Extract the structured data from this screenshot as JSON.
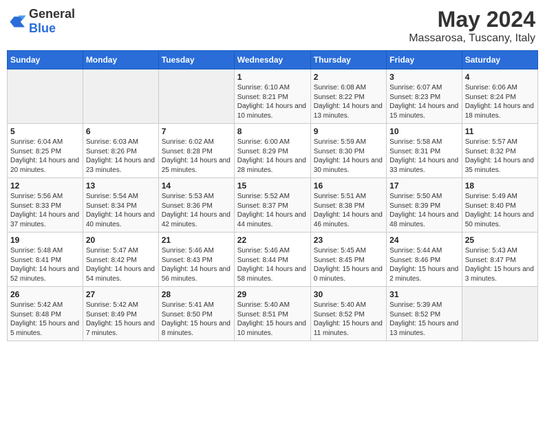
{
  "logo": {
    "general": "General",
    "blue": "Blue"
  },
  "header": {
    "month": "May 2024",
    "location": "Massarosa, Tuscany, Italy"
  },
  "weekdays": [
    "Sunday",
    "Monday",
    "Tuesday",
    "Wednesday",
    "Thursday",
    "Friday",
    "Saturday"
  ],
  "weeks": [
    [
      {
        "day": "",
        "sunrise": "",
        "sunset": "",
        "daylight": ""
      },
      {
        "day": "",
        "sunrise": "",
        "sunset": "",
        "daylight": ""
      },
      {
        "day": "",
        "sunrise": "",
        "sunset": "",
        "daylight": ""
      },
      {
        "day": "1",
        "sunrise": "Sunrise: 6:10 AM",
        "sunset": "Sunset: 8:21 PM",
        "daylight": "Daylight: 14 hours and 10 minutes."
      },
      {
        "day": "2",
        "sunrise": "Sunrise: 6:08 AM",
        "sunset": "Sunset: 8:22 PM",
        "daylight": "Daylight: 14 hours and 13 minutes."
      },
      {
        "day": "3",
        "sunrise": "Sunrise: 6:07 AM",
        "sunset": "Sunset: 8:23 PM",
        "daylight": "Daylight: 14 hours and 15 minutes."
      },
      {
        "day": "4",
        "sunrise": "Sunrise: 6:06 AM",
        "sunset": "Sunset: 8:24 PM",
        "daylight": "Daylight: 14 hours and 18 minutes."
      }
    ],
    [
      {
        "day": "5",
        "sunrise": "Sunrise: 6:04 AM",
        "sunset": "Sunset: 8:25 PM",
        "daylight": "Daylight: 14 hours and 20 minutes."
      },
      {
        "day": "6",
        "sunrise": "Sunrise: 6:03 AM",
        "sunset": "Sunset: 8:26 PM",
        "daylight": "Daylight: 14 hours and 23 minutes."
      },
      {
        "day": "7",
        "sunrise": "Sunrise: 6:02 AM",
        "sunset": "Sunset: 8:28 PM",
        "daylight": "Daylight: 14 hours and 25 minutes."
      },
      {
        "day": "8",
        "sunrise": "Sunrise: 6:00 AM",
        "sunset": "Sunset: 8:29 PM",
        "daylight": "Daylight: 14 hours and 28 minutes."
      },
      {
        "day": "9",
        "sunrise": "Sunrise: 5:59 AM",
        "sunset": "Sunset: 8:30 PM",
        "daylight": "Daylight: 14 hours and 30 minutes."
      },
      {
        "day": "10",
        "sunrise": "Sunrise: 5:58 AM",
        "sunset": "Sunset: 8:31 PM",
        "daylight": "Daylight: 14 hours and 33 minutes."
      },
      {
        "day": "11",
        "sunrise": "Sunrise: 5:57 AM",
        "sunset": "Sunset: 8:32 PM",
        "daylight": "Daylight: 14 hours and 35 minutes."
      }
    ],
    [
      {
        "day": "12",
        "sunrise": "Sunrise: 5:56 AM",
        "sunset": "Sunset: 8:33 PM",
        "daylight": "Daylight: 14 hours and 37 minutes."
      },
      {
        "day": "13",
        "sunrise": "Sunrise: 5:54 AM",
        "sunset": "Sunset: 8:34 PM",
        "daylight": "Daylight: 14 hours and 40 minutes."
      },
      {
        "day": "14",
        "sunrise": "Sunrise: 5:53 AM",
        "sunset": "Sunset: 8:36 PM",
        "daylight": "Daylight: 14 hours and 42 minutes."
      },
      {
        "day": "15",
        "sunrise": "Sunrise: 5:52 AM",
        "sunset": "Sunset: 8:37 PM",
        "daylight": "Daylight: 14 hours and 44 minutes."
      },
      {
        "day": "16",
        "sunrise": "Sunrise: 5:51 AM",
        "sunset": "Sunset: 8:38 PM",
        "daylight": "Daylight: 14 hours and 46 minutes."
      },
      {
        "day": "17",
        "sunrise": "Sunrise: 5:50 AM",
        "sunset": "Sunset: 8:39 PM",
        "daylight": "Daylight: 14 hours and 48 minutes."
      },
      {
        "day": "18",
        "sunrise": "Sunrise: 5:49 AM",
        "sunset": "Sunset: 8:40 PM",
        "daylight": "Daylight: 14 hours and 50 minutes."
      }
    ],
    [
      {
        "day": "19",
        "sunrise": "Sunrise: 5:48 AM",
        "sunset": "Sunset: 8:41 PM",
        "daylight": "Daylight: 14 hours and 52 minutes."
      },
      {
        "day": "20",
        "sunrise": "Sunrise: 5:47 AM",
        "sunset": "Sunset: 8:42 PM",
        "daylight": "Daylight: 14 hours and 54 minutes."
      },
      {
        "day": "21",
        "sunrise": "Sunrise: 5:46 AM",
        "sunset": "Sunset: 8:43 PM",
        "daylight": "Daylight: 14 hours and 56 minutes."
      },
      {
        "day": "22",
        "sunrise": "Sunrise: 5:46 AM",
        "sunset": "Sunset: 8:44 PM",
        "daylight": "Daylight: 14 hours and 58 minutes."
      },
      {
        "day": "23",
        "sunrise": "Sunrise: 5:45 AM",
        "sunset": "Sunset: 8:45 PM",
        "daylight": "Daylight: 15 hours and 0 minutes."
      },
      {
        "day": "24",
        "sunrise": "Sunrise: 5:44 AM",
        "sunset": "Sunset: 8:46 PM",
        "daylight": "Daylight: 15 hours and 2 minutes."
      },
      {
        "day": "25",
        "sunrise": "Sunrise: 5:43 AM",
        "sunset": "Sunset: 8:47 PM",
        "daylight": "Daylight: 15 hours and 3 minutes."
      }
    ],
    [
      {
        "day": "26",
        "sunrise": "Sunrise: 5:42 AM",
        "sunset": "Sunset: 8:48 PM",
        "daylight": "Daylight: 15 hours and 5 minutes."
      },
      {
        "day": "27",
        "sunrise": "Sunrise: 5:42 AM",
        "sunset": "Sunset: 8:49 PM",
        "daylight": "Daylight: 15 hours and 7 minutes."
      },
      {
        "day": "28",
        "sunrise": "Sunrise: 5:41 AM",
        "sunset": "Sunset: 8:50 PM",
        "daylight": "Daylight: 15 hours and 8 minutes."
      },
      {
        "day": "29",
        "sunrise": "Sunrise: 5:40 AM",
        "sunset": "Sunset: 8:51 PM",
        "daylight": "Daylight: 15 hours and 10 minutes."
      },
      {
        "day": "30",
        "sunrise": "Sunrise: 5:40 AM",
        "sunset": "Sunset: 8:52 PM",
        "daylight": "Daylight: 15 hours and 11 minutes."
      },
      {
        "day": "31",
        "sunrise": "Sunrise: 5:39 AM",
        "sunset": "Sunset: 8:52 PM",
        "daylight": "Daylight: 15 hours and 13 minutes."
      },
      {
        "day": "",
        "sunrise": "",
        "sunset": "",
        "daylight": ""
      }
    ]
  ]
}
